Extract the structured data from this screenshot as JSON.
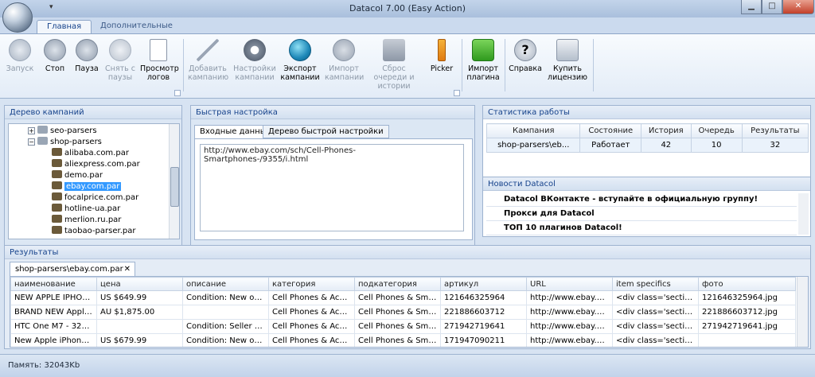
{
  "window": {
    "title": "Datacol 7.00 (Easy Action)",
    "qat": "▾"
  },
  "ribbon_tabs": [
    "Главная",
    "Дополнительные"
  ],
  "ribbon": {
    "zapusk": "Запуск",
    "stop": "Стоп",
    "pauza": "Пауза",
    "snyat": "Снять с паузы",
    "logs": "Просмотр логов",
    "add": "Добавить кампанию",
    "settings": "Настройки кампании",
    "export": "Экспорт кампании",
    "import": "Импорт кампании",
    "reset": "Сброс очереди и истории",
    "picker": "Picker",
    "plugin": "Импорт плагина",
    "help": "Справка",
    "license": "Купить лицензию"
  },
  "tree": {
    "title": "Дерево кампаний",
    "items": [
      "seo-parsers",
      "shop-parsers",
      "alibaba.com.par",
      "aliexpress.com.par",
      "demo.par",
      "ebay.com.par",
      "focalprice.com.par",
      "hotline-ua.par",
      "merlion.ru.par",
      "taobao-parser.par"
    ]
  },
  "quick": {
    "title": "Быстрая настройка",
    "tab1": "Входные данные",
    "tab2": "Дерево быстрой настройки",
    "url": "http://www.ebay.com/sch/Cell-Phones-Smartphones-/9355/i.html"
  },
  "stats": {
    "title": "Статистика работы",
    "headers": [
      "Кампания",
      "Состояние",
      "История",
      "Очередь",
      "Результаты"
    ],
    "row": [
      "shop-parsers\\eb...",
      "Работает",
      "42",
      "10",
      "32"
    ]
  },
  "news": {
    "title": "Новости Datacol",
    "items": [
      "Datacol ВКонтакте - вступайте в официальную группу!",
      "Прокси для Datacol",
      "ТОП 10 плагинов Datacol!"
    ]
  },
  "results": {
    "title": "Результаты",
    "doc_tab": "shop-parsers\\ebay.com.par",
    "headers": [
      "наименование",
      "цена",
      "описание",
      "категория",
      "подкатегория",
      "артикул",
      "URL",
      "item specifics",
      "фото"
    ],
    "rows": [
      [
        "NEW APPLE IPHONE ...",
        "US $649.99",
        "Condition: New other...",
        "Cell Phones & Access...",
        "Cell Phones & Smartp...",
        "121646325964",
        "http://www.ebay.co...",
        "<div class='section'>...",
        "121646325964.jpg"
      ],
      [
        "BRAND NEW Apple iP...",
        "AU $1,875.00",
        "",
        "Cell Phones & Access...",
        "Cell Phones & Smartp...",
        "221886603712",
        "http://www.ebay.co...",
        "<div class='section'>...",
        "221886603712.jpg"
      ],
      [
        "HTC One M7 - 32GB B...",
        "",
        "Condition: Seller refu...",
        "Cell Phones & Access...",
        "Cell Phones & Smartp...",
        "271942719641",
        "http://www.ebay.co...",
        "<div class='section'>...",
        "271942719641.jpg"
      ],
      [
        "New Apple iPhone 6 P...",
        "US $679.99",
        "Condition: New other...",
        "Cell Phones & Access...",
        "Cell Phones & Smartp...",
        "171947090211",
        "http://www.ebay.co...",
        "<div class='section'>...",
        ""
      ]
    ]
  },
  "status": "Память: 32043Kb"
}
